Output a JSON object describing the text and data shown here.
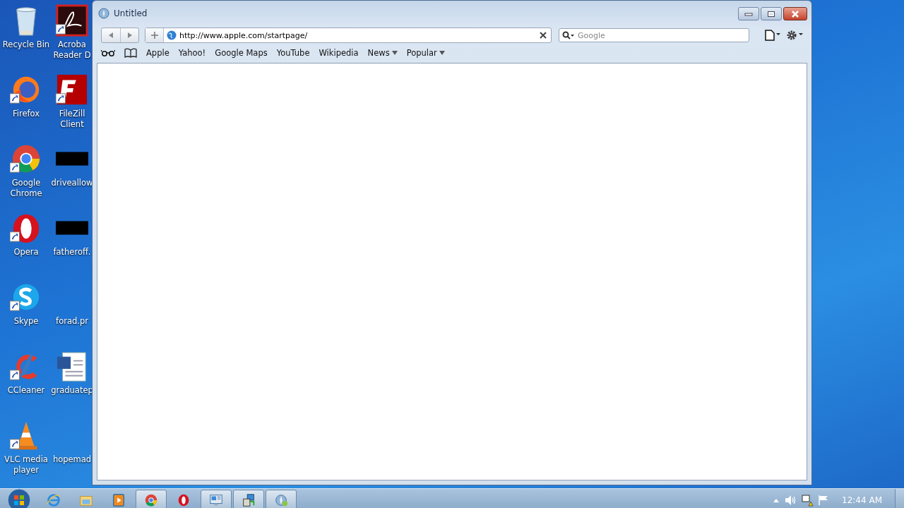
{
  "desktop_icons": [
    {
      "kind": "recycle-bin",
      "lines": [
        "Recycle Bin"
      ],
      "shortcut": false
    },
    {
      "kind": "firefox",
      "lines": [
        "Firefox"
      ],
      "shortcut": true
    },
    {
      "kind": "chrome",
      "lines": [
        "Google",
        "Chrome"
      ],
      "shortcut": true
    },
    {
      "kind": "opera",
      "lines": [
        "Opera"
      ],
      "shortcut": true
    },
    {
      "kind": "skype",
      "lines": [
        "Skype"
      ],
      "shortcut": true
    },
    {
      "kind": "ccleaner",
      "lines": [
        "CCleaner"
      ],
      "shortcut": true
    },
    {
      "kind": "vlc",
      "lines": [
        "VLC media",
        "player"
      ],
      "shortcut": true
    },
    {
      "kind": "acrobat",
      "lines": [
        "Acroba",
        "Reader D"
      ],
      "shortcut": true
    },
    {
      "kind": "filezilla",
      "lines": [
        "FileZill",
        "Client"
      ],
      "shortcut": true
    },
    {
      "kind": "redacted",
      "lines": [
        "driveallow"
      ],
      "shortcut": false
    },
    {
      "kind": "redacted",
      "lines": [
        "fatheroff."
      ],
      "shortcut": false
    },
    {
      "kind": "blank",
      "lines": [
        "forad.pr"
      ],
      "shortcut": false
    },
    {
      "kind": "word",
      "lines": [
        "graduatep"
      ],
      "shortcut": false
    },
    {
      "kind": "blank",
      "lines": [
        "hopemad"
      ],
      "shortcut": false
    }
  ],
  "window": {
    "title": "Untitled",
    "toolbar": {
      "address": "http://www.apple.com/startpage/",
      "search": {
        "placeholder": "Google"
      }
    },
    "bookmarks": [
      {
        "label": "Apple",
        "menu": false
      },
      {
        "label": "Yahoo!",
        "menu": false
      },
      {
        "label": "Google Maps",
        "menu": false
      },
      {
        "label": "YouTube",
        "menu": false
      },
      {
        "label": "Wikipedia",
        "menu": false
      },
      {
        "label": "News",
        "menu": true
      },
      {
        "label": "Popular",
        "menu": true
      }
    ]
  },
  "taskbar": {
    "items": [
      {
        "kind": "ie",
        "running": false
      },
      {
        "kind": "explorer",
        "running": false
      },
      {
        "kind": "media",
        "running": false
      },
      {
        "kind": "chrome",
        "running": true
      },
      {
        "kind": "opera",
        "running": false
      },
      {
        "kind": "monitor",
        "running": true
      },
      {
        "kind": "installer",
        "running": true
      },
      {
        "kind": "safari",
        "running": true
      }
    ],
    "clock": "12:44 AM"
  }
}
